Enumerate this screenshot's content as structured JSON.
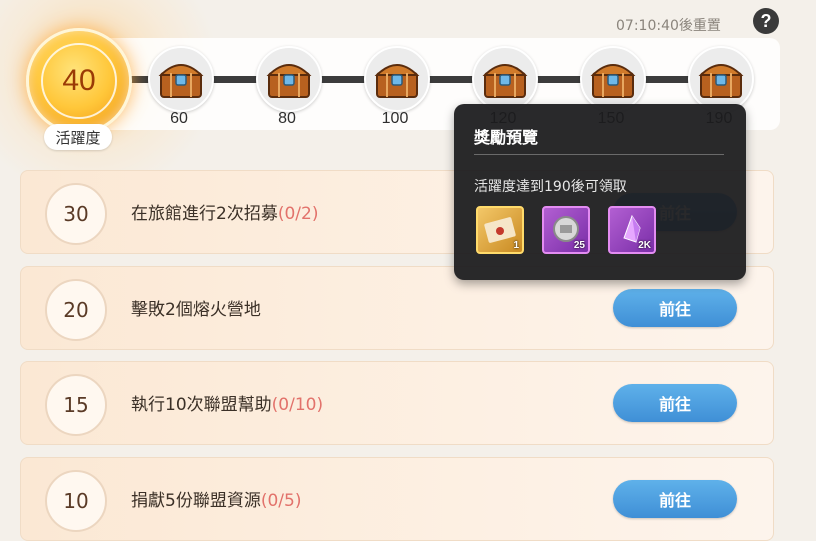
{
  "header": {
    "reset_timer": "07:10:40後重置",
    "help_icon": "?"
  },
  "activity": {
    "current_value": "40",
    "label": "活躍度"
  },
  "milestones": [
    {
      "value": "60",
      "icon": "treasure-chest-icon"
    },
    {
      "value": "80",
      "icon": "treasure-chest-icon"
    },
    {
      "value": "100",
      "icon": "treasure-chest-icon"
    },
    {
      "value": "120",
      "icon": "treasure-chest-icon"
    },
    {
      "value": "150",
      "icon": "treasure-chest-icon"
    },
    {
      "value": "190",
      "icon": "treasure-chest-icon"
    }
  ],
  "tasks": [
    {
      "points": "30",
      "text": "在旅館進行2次招募",
      "progress": "(0/2)",
      "button": "前往"
    },
    {
      "points": "20",
      "text": "擊敗2個熔火營地",
      "progress": "",
      "button": "前往"
    },
    {
      "points": "15",
      "text": "執行10次聯盟幫助",
      "progress": "(0/10)",
      "button": "前往"
    },
    {
      "points": "10",
      "text": "捐獻5份聯盟資源",
      "progress": "(0/5)",
      "button": "前往"
    }
  ],
  "tooltip": {
    "title": "獎勵預覽",
    "description": "活躍度達到190後可領取",
    "rewards": [
      {
        "icon": "sealed-letter-icon",
        "count": "1",
        "rarity_color": "#e8b84a"
      },
      {
        "icon": "silver-coin-icon",
        "count": "25",
        "rarity_color": "#b35ad0"
      },
      {
        "icon": "purple-crystal-icon",
        "count": "2K",
        "rarity_color": "#b35ad0"
      }
    ]
  },
  "colors": {
    "go_button": "#4a9ee0",
    "progress_text": "#e2726b",
    "orb": "#ffc73a"
  }
}
